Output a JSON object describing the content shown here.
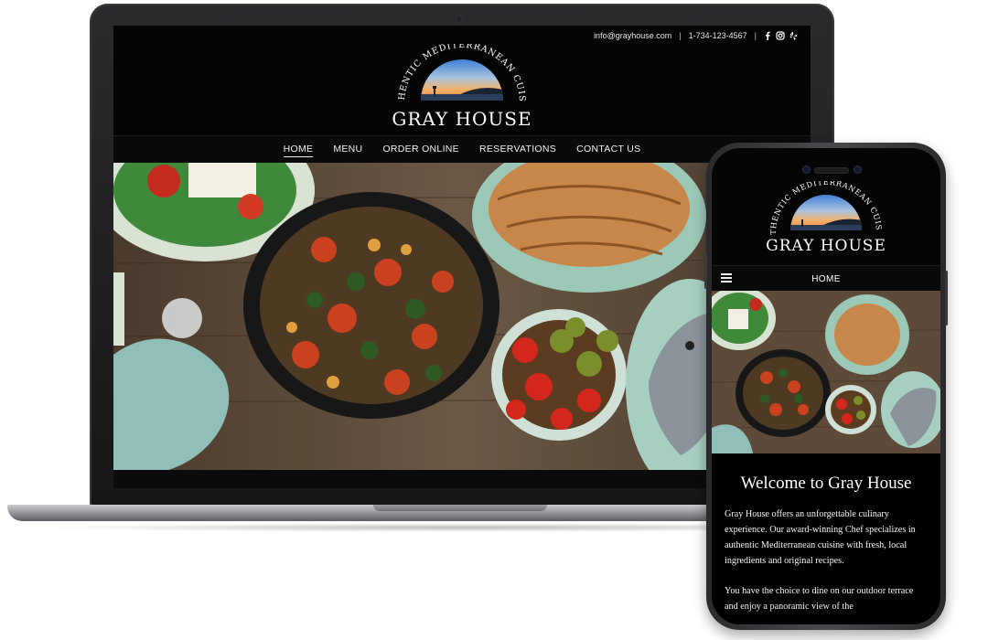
{
  "site": {
    "name": "GRAY HOUSE",
    "tagline": "AUTHENTIC MEDITERRANEAN CUISINE"
  },
  "desktop": {
    "contact": {
      "email": "info@grayhouse.com",
      "separator": "|",
      "phone": "1-734-123-4567"
    },
    "social_icons": [
      "facebook-icon",
      "instagram-icon",
      "yelp-icon"
    ],
    "nav": [
      "HOME",
      "MENU",
      "ORDER ONLINE",
      "RESERVATIONS",
      "CONTACT US"
    ],
    "active_nav": "HOME"
  },
  "mobile": {
    "nav_current": "HOME",
    "welcome_title": "Welcome to Gray House",
    "paragraph1": "Gray House offers an unforgettable culinary experience. Our award-winning Chef specializes in authentic Mediterranean cuisine with fresh, local ingredients and original recipes.",
    "paragraph2": "You have the choice to dine on our outdoor terrace and enjoy a panoramic view of the"
  },
  "colors": {
    "page_bg": "#ffffff",
    "site_bg": "#050505",
    "text": "#ffffff"
  }
}
